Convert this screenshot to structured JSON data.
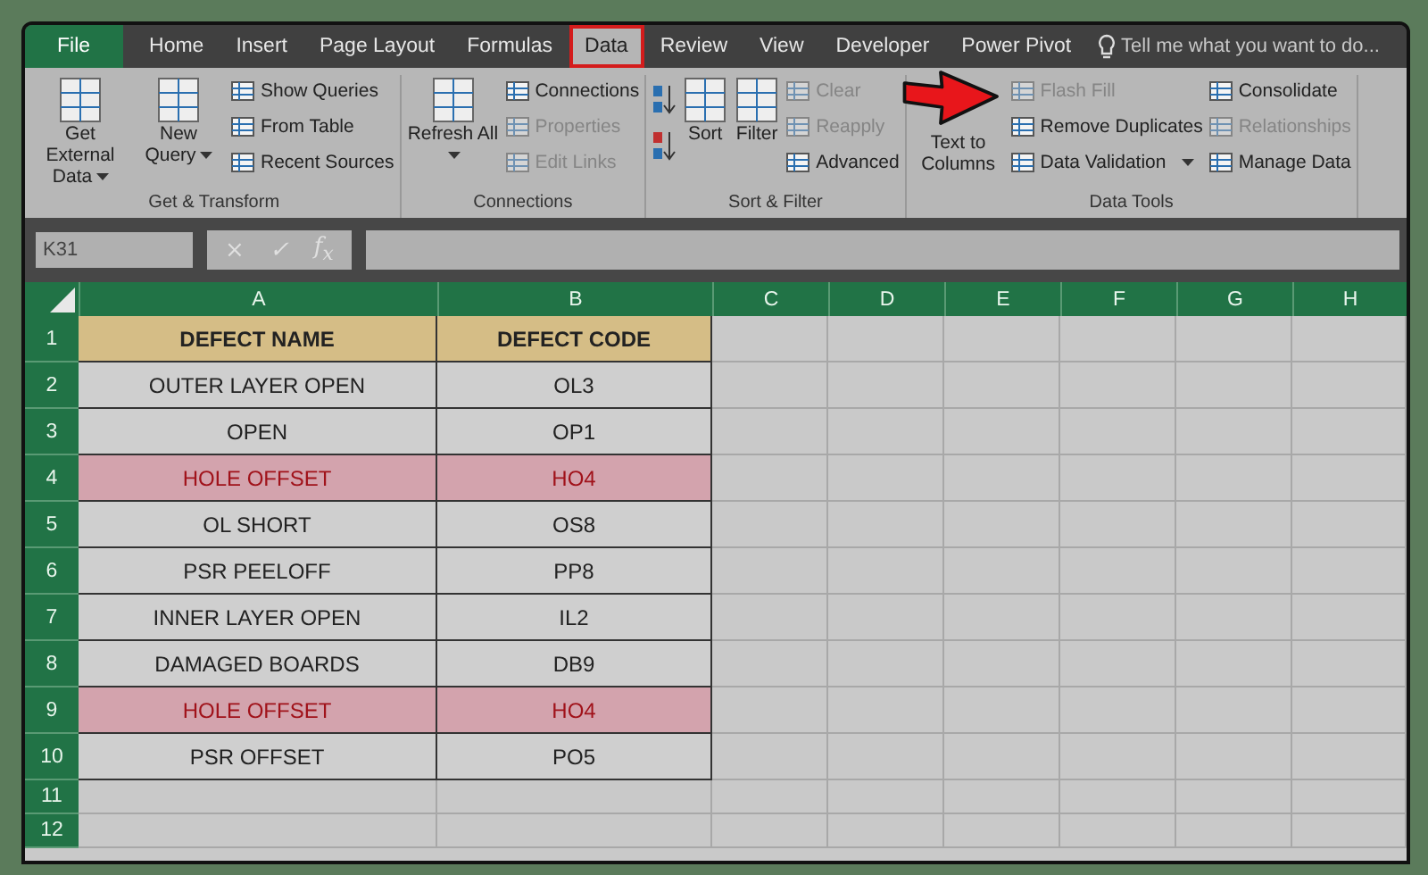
{
  "tabs": [
    {
      "label": "File",
      "kind": "file",
      "selected": false
    },
    {
      "label": "Home",
      "kind": "tab",
      "selected": false
    },
    {
      "label": "Insert",
      "kind": "tab",
      "selected": false
    },
    {
      "label": "Page Layout",
      "kind": "tab",
      "selected": false
    },
    {
      "label": "Formulas",
      "kind": "tab",
      "selected": false
    },
    {
      "label": "Data",
      "kind": "tab",
      "selected": true
    },
    {
      "label": "Review",
      "kind": "tab",
      "selected": false
    },
    {
      "label": "View",
      "kind": "tab",
      "selected": false
    },
    {
      "label": "Developer",
      "kind": "tab",
      "selected": false
    },
    {
      "label": "Power Pivot",
      "kind": "tab",
      "selected": false
    }
  ],
  "tell_me": {
    "placeholder": "Tell me what you want to do..."
  },
  "ribbon_groups": [
    {
      "label": "Get & Transform",
      "items": [
        {
          "kind": "large",
          "label": "Get External Data",
          "dropdown": true,
          "disabled": false
        },
        {
          "kind": "large",
          "label": "New Query",
          "dropdown": true,
          "disabled": false
        },
        {
          "kind": "small",
          "label": "Show Queries",
          "dropdown": false,
          "disabled": false
        },
        {
          "kind": "small",
          "label": "From Table",
          "dropdown": false,
          "disabled": false
        },
        {
          "kind": "small",
          "label": "Recent Sources",
          "dropdown": false,
          "disabled": false
        }
      ]
    },
    {
      "label": "Connections",
      "items": [
        {
          "kind": "large",
          "label": "Refresh All",
          "dropdown": true,
          "disabled": false
        },
        {
          "kind": "small",
          "label": "Connections",
          "dropdown": false,
          "disabled": false
        },
        {
          "kind": "small",
          "label": "Properties",
          "dropdown": false,
          "disabled": true
        },
        {
          "kind": "small",
          "label": "Edit Links",
          "dropdown": false,
          "disabled": true
        }
      ]
    },
    {
      "label": "Sort & Filter",
      "items": [
        {
          "kind": "sort-icons"
        },
        {
          "kind": "large",
          "label": "Sort",
          "dropdown": false,
          "disabled": false
        },
        {
          "kind": "large",
          "label": "Filter",
          "dropdown": false,
          "disabled": false
        },
        {
          "kind": "small",
          "label": "Clear",
          "dropdown": false,
          "disabled": true
        },
        {
          "kind": "small",
          "label": "Reapply",
          "dropdown": false,
          "disabled": true
        },
        {
          "kind": "small",
          "label": "Advanced",
          "dropdown": false,
          "disabled": false
        }
      ]
    },
    {
      "label": "Data Tools",
      "items": [
        {
          "kind": "large",
          "label": "Text to Columns",
          "dropdown": false,
          "disabled": false,
          "icon_covered": true
        },
        {
          "kind": "small",
          "label": "Flash Fill",
          "dropdown": false,
          "disabled": true
        },
        {
          "kind": "small",
          "label": "Remove Duplicates",
          "dropdown": false,
          "disabled": false
        },
        {
          "kind": "small",
          "label": "Data Validation",
          "dropdown": true,
          "disabled": false
        },
        {
          "kind": "small",
          "label": "Consolidate",
          "dropdown": false,
          "disabled": false
        },
        {
          "kind": "small",
          "label": "Relationships",
          "dropdown": false,
          "disabled": true
        },
        {
          "kind": "small",
          "label": "Manage Data",
          "dropdown": false,
          "disabled": false
        }
      ]
    }
  ],
  "formula_bar": {
    "name_box": "K31",
    "buttons": [
      "×",
      "✓",
      "f$_{x}$"
    ]
  },
  "columns": [
    "A",
    "B",
    "C",
    "D",
    "E",
    "F",
    "G",
    "H"
  ],
  "rows": [
    {
      "number": "1",
      "kind": "header",
      "highlighted": false,
      "cells": [
        "DEFECT NAME",
        "DEFECT CODE"
      ]
    },
    {
      "number": "2",
      "kind": "data",
      "highlighted": false,
      "cells": [
        "OUTER LAYER OPEN",
        "OL3"
      ]
    },
    {
      "number": "3",
      "kind": "data",
      "highlighted": false,
      "cells": [
        "OPEN",
        "OP1"
      ]
    },
    {
      "number": "4",
      "kind": "data",
      "highlighted": true,
      "cells": [
        "HOLE OFFSET",
        "HO4"
      ]
    },
    {
      "number": "5",
      "kind": "data",
      "highlighted": false,
      "cells": [
        "OL SHORT",
        "OS8"
      ]
    },
    {
      "number": "6",
      "kind": "data",
      "highlighted": false,
      "cells": [
        "PSR PEELOFF",
        "PP8"
      ]
    },
    {
      "number": "7",
      "kind": "data",
      "highlighted": false,
      "cells": [
        "INNER LAYER OPEN",
        "IL2"
      ]
    },
    {
      "number": "8",
      "kind": "data",
      "highlighted": false,
      "cells": [
        "DAMAGED BOARDS",
        "DB9"
      ]
    },
    {
      "number": "9",
      "kind": "data",
      "highlighted": true,
      "cells": [
        "HOLE OFFSET",
        "HO4"
      ]
    },
    {
      "number": "10",
      "kind": "data",
      "highlighted": false,
      "cells": [
        "PSR OFFSET",
        "PO5"
      ]
    },
    {
      "number": "11",
      "kind": "empty",
      "highlighted": false,
      "cells": []
    },
    {
      "number": "12",
      "kind": "empty",
      "highlighted": false,
      "cells": []
    }
  ]
}
